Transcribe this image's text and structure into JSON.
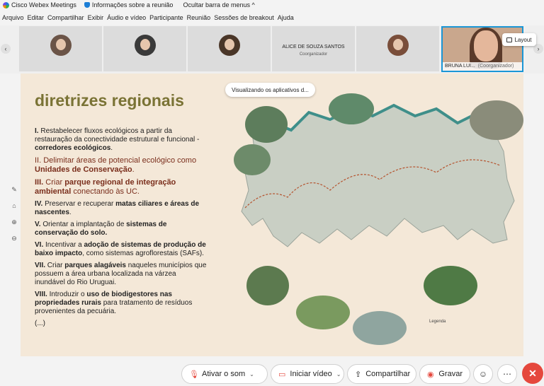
{
  "app": {
    "title": "Cisco Webex Meetings",
    "meeting_info": "Informações sobre a reunião",
    "hide_menu": "Ocultar barra de menus"
  },
  "menu": [
    "Arquivo",
    "Editar",
    "Compartilhar",
    "Exibir",
    "Áudio e vídeo",
    "Participante",
    "Reunião",
    "Sessões de breakout",
    "Ajuda"
  ],
  "participants": {
    "named_tile": {
      "name": "ALICE DE SOUZA SANTOS",
      "role": "Coorganizador"
    },
    "speaker": {
      "name": "BRUNA LUI...",
      "role": "(Coorganizador)"
    },
    "layout_label": "Layout"
  },
  "share_tooltip": "Visualizando os aplicativos d...",
  "slide": {
    "title": "diretrizes regionais",
    "items": [
      {
        "num": "I.",
        "pre": "Restabelecer fluxos ecológicos a partir da restauração da conectividade estrutural e funcional - ",
        "bold": "corredores ecológicos",
        "post": "."
      },
      {
        "num": "II.",
        "pre": "Delimitar áreas de potencial ecológico como ",
        "bold": "Unidades de Conservação",
        "post": "."
      },
      {
        "num": "III.",
        "pre": "Criar ",
        "bold": "parque regional de integração ambiental",
        "post": " conectando às UC."
      },
      {
        "num": "IV.",
        "pre": "Preservar e recuperar ",
        "bold": "matas ciliares e áreas de nascentes",
        "post": "."
      },
      {
        "num": "V.",
        "pre": "Orientar a implantação de ",
        "bold": "sistemas de conservação do solo.",
        "post": ""
      },
      {
        "num": "VI.",
        "pre": "Incentivar a ",
        "bold": "adoção de sistemas de produção de baixo impacto",
        "post": ", como sistemas agroflorestais (SAFs)."
      },
      {
        "num": "VII.",
        "pre": "Criar ",
        "bold": "parques alagáveis",
        "post": " naqueles municípios que possuem a área urbana localizada na várzea inundável do Rio Uruguai."
      },
      {
        "num": "VIII.",
        "pre": "Introduzir o ",
        "bold": "uso de biodigestores nas propriedades rurais",
        "post": " para tratamento de resíduos provenientes da pecuária."
      }
    ],
    "ellipsis": "(...)",
    "legend_title": "Legenda"
  },
  "toolbar": {
    "mute": "Ativar o som",
    "video": "Iniciar vídeo",
    "share": "Compartilhar",
    "record": "Gravar"
  },
  "colors": {
    "accent": "#1a96d6",
    "end_call": "#e5483d",
    "slide_title": "#7a7335",
    "slide_bg": "#f4e8d8"
  }
}
